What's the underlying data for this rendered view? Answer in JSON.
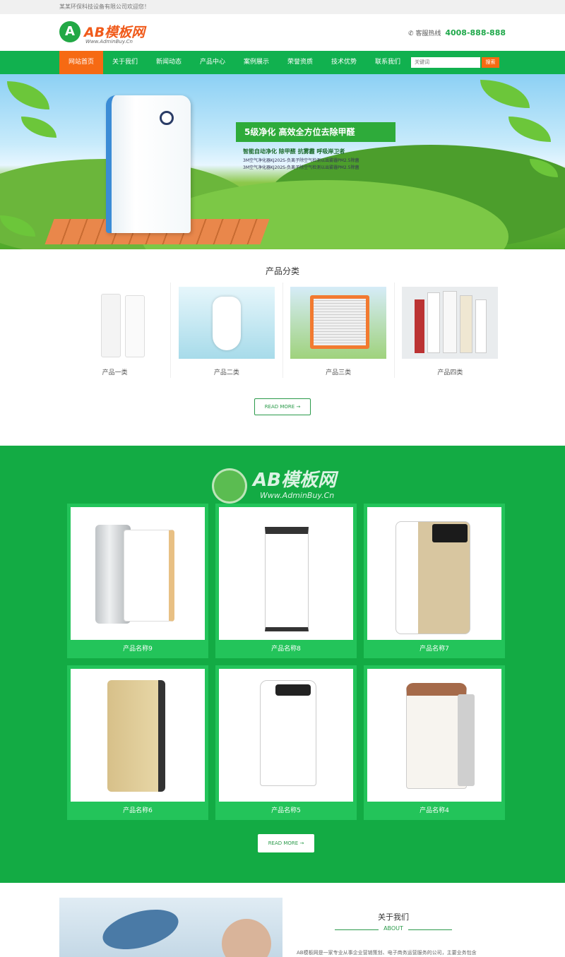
{
  "topbar": {
    "welcome": "某某环保科技设备有限公司欢迎您！"
  },
  "header": {
    "logo_mark": "A",
    "logo_name": "AB模板网",
    "logo_sub": "Www.AdminBuy.Cn",
    "hotline_label": "客服热线",
    "hotline_number": "4008-888-888"
  },
  "nav": {
    "items": [
      "网站首页",
      "关于我们",
      "新闻动态",
      "产品中心",
      "案例展示",
      "荣誉资质",
      "技术优势",
      "联系我们"
    ],
    "search_placeholder": "关键词",
    "search_button": "搜索"
  },
  "banner": {
    "slogan": "5级净化  高效全方位去除甲醛",
    "line1": "智能自动净化  除甲醛  抗雾霾  呼吸岸卫者",
    "line2": "3M空气净化器KJ202S-负离子除空气检测以出雾霾PM2.5除菌",
    "line3": "3M空气净化器KJ202S-负离子除空气检测以出雾霾PM2.5除菌"
  },
  "categories": {
    "title": "产品分类",
    "items": [
      {
        "label": "产品一类"
      },
      {
        "label": "产品二类"
      },
      {
        "label": "产品三类"
      },
      {
        "label": "产品四类"
      }
    ],
    "more": "READ MORE →"
  },
  "products": {
    "watermark_name": "AB模板网",
    "watermark_sub": "Www.AdminBuy.Cn",
    "items": [
      {
        "name": "产品名称9"
      },
      {
        "name": "产品名称8"
      },
      {
        "name": "产品名称7"
      },
      {
        "name": "产品名称6"
      },
      {
        "name": "产品名称5"
      },
      {
        "name": "产品名称4"
      }
    ],
    "more": "READ MORE →"
  },
  "about": {
    "title": "关于我们",
    "subtitle": "ABOUT",
    "text": "AB模板网是一家专业从事企业营销策划、电子商务运营服务的公司，主要业务包含"
  },
  "colors": {
    "brand_green": "#11b14f",
    "accent_orange": "#f66a13"
  }
}
